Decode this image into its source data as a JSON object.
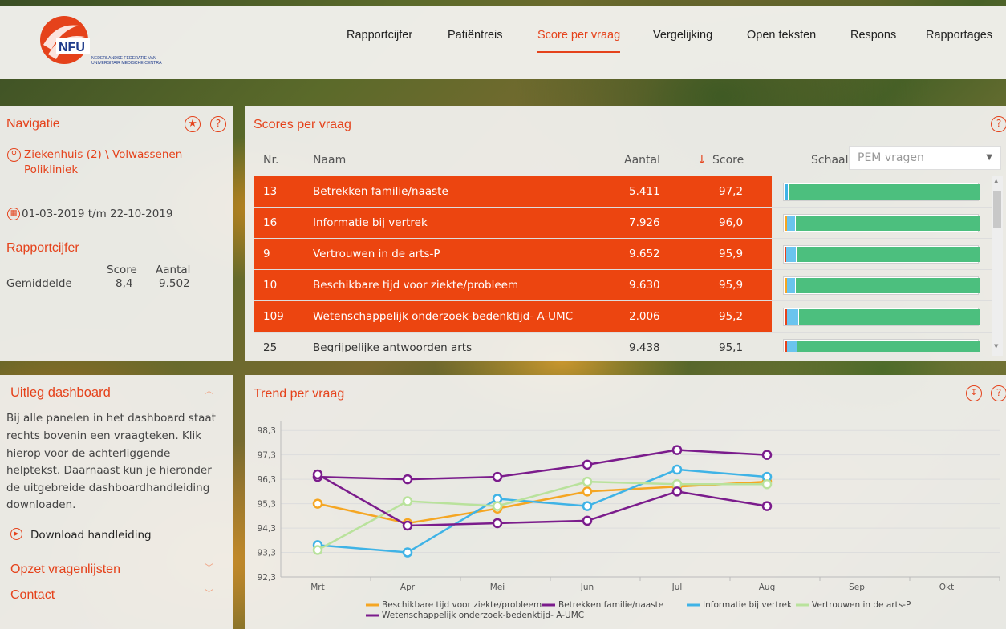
{
  "header": {
    "logo_text": "NFU",
    "logo_subtitle_1": "NEDERLANDSE FEDERATIE VAN",
    "logo_subtitle_2": "UNIVERSITAIR MEDISCHE CENTRA",
    "nav": [
      "Rapportcijfer",
      "Patiëntreis",
      "Score per vraag",
      "Vergelijking",
      "Open teksten",
      "Respons",
      "Rapportages"
    ],
    "active_nav": "Score per vraag"
  },
  "navigation": {
    "title": "Navigatie",
    "location_line1": "Ziekenhuis (2) \\ Volwassenen",
    "location_line2": "Polikliniek",
    "date_range": "01-03-2019 t/m 22-10-2019",
    "rapportcijfer_title": "Rapportcijfer",
    "col_score": "Score",
    "col_aantal": "Aantal",
    "row_label": "Gemiddelde",
    "score": "8,4",
    "aantal": "9.502"
  },
  "uitleg": {
    "title": "Uitleg dashboard",
    "lines": [
      "Bij alle panelen in het dashboard staat",
      "rechts bovenin een vraagteken. Klik",
      "hierop voor de achterliggende",
      "helptekst. Daarnaast kun je hieronder",
      "de uitgebreide dashboardhandleiding",
      "downloaden."
    ],
    "download": "Download handleiding",
    "opzet": "Opzet vragenlijsten",
    "contact": "Contact"
  },
  "scores": {
    "title": "Scores per vraag",
    "col_nr": "Nr.",
    "col_naam": "Naam",
    "col_aantal": "Aantal",
    "col_score": "Score",
    "schaal_label": "Schaal",
    "schaal_value": "PEM vragen",
    "rows": [
      {
        "nr": "13",
        "naam": "Betrekken familie/naaste",
        "aantal": "5.411",
        "score": "97,2",
        "hl": true
      },
      {
        "nr": "16",
        "naam": "Informatie bij vertrek",
        "aantal": "7.926",
        "score": "96,0",
        "hl": true
      },
      {
        "nr": "9",
        "naam": "Vertrouwen in de arts-P",
        "aantal": "9.652",
        "score": "95,9",
        "hl": true
      },
      {
        "nr": "10",
        "naam": "Beschikbare tijd voor ziekte/probleem",
        "aantal": "9.630",
        "score": "95,9",
        "hl": true
      },
      {
        "nr": "109",
        "naam": "Wetenschappelijk onderzoek-bedenktijd- A-UMC",
        "aantal": "2.006",
        "score": "95,2",
        "hl": true
      },
      {
        "nr": "25",
        "naam": "Begrijpelijke antwoorden arts",
        "aantal": "9.438",
        "score": "95,1",
        "hl": false
      }
    ]
  },
  "trend": {
    "title": "Trend per vraag"
  },
  "chart_data": {
    "type": "line",
    "title": "Trend per vraag",
    "x": [
      "Mrt",
      "Apr",
      "Mei",
      "Jun",
      "Jul",
      "Aug",
      "Sep",
      "Okt"
    ],
    "y_ticks": [
      "92,3",
      "93,3",
      "94,3",
      "95,3",
      "96,3",
      "97,3",
      "98,3"
    ],
    "ylim": [
      92.3,
      98.7
    ],
    "series": [
      {
        "name": "Beschikbare tijd voor ziekte/probleem",
        "color": "#f5a623",
        "values": [
          95.3,
          94.5,
          95.1,
          95.8,
          96.0,
          96.2,
          null,
          null
        ]
      },
      {
        "name": "Betrekken familie/naaste",
        "color": "#7b1c8c",
        "values": [
          96.4,
          96.3,
          96.4,
          96.9,
          97.5,
          97.3,
          null,
          null
        ]
      },
      {
        "name": "Informatie bij vertrek",
        "color": "#3fb3e6",
        "values": [
          93.6,
          93.3,
          95.5,
          95.2,
          96.7,
          96.4,
          null,
          null
        ]
      },
      {
        "name": "Vertrouwen in de arts-P",
        "color": "#b9e29c",
        "values": [
          93.4,
          95.4,
          95.2,
          96.2,
          96.1,
          96.1,
          null,
          null
        ]
      },
      {
        "name": "Wetenschappelijk onderzoek-bedenktijd- A-UMC",
        "color": "#7b1c8c",
        "values": [
          96.5,
          94.4,
          94.5,
          94.6,
          95.8,
          95.2,
          null,
          null
        ]
      }
    ]
  }
}
